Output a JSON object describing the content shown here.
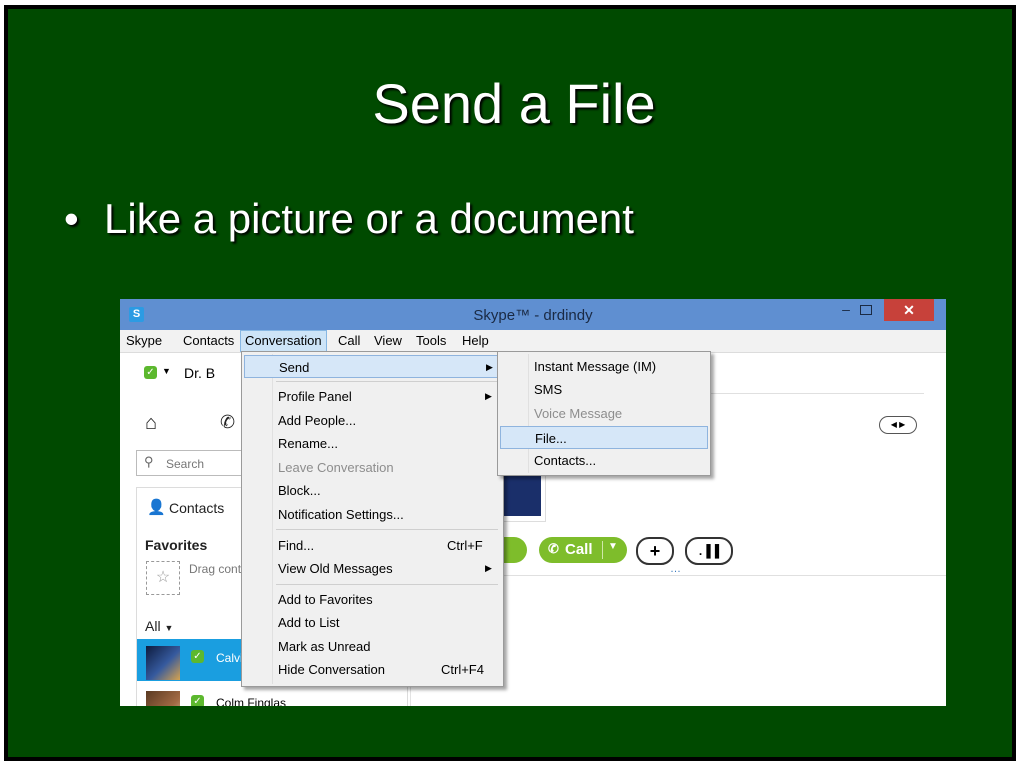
{
  "slide": {
    "title": "Send a File",
    "bullet": "Like a picture or a document"
  },
  "window": {
    "logo": "S",
    "title": "Skype™ - drdindy",
    "close_symbol": "✕",
    "min_symbol": "–"
  },
  "menubar": [
    "Skype",
    "Contacts",
    "Conversation",
    "Call",
    "View",
    "Tools",
    "Help"
  ],
  "user": {
    "name": "Dr. B"
  },
  "search": {
    "placeholder": "Search"
  },
  "contacts": {
    "header": "Contacts",
    "favorites": "Favorites",
    "drag_text": "Drag cont",
    "all_label": "All",
    "rows": [
      {
        "name": "Calvi",
        "selected": true
      },
      {
        "name": "Colm Finglas",
        "selected": false
      }
    ]
  },
  "conversation": {
    "partial_call": "all",
    "call_label": "Call",
    "add_symbol": "+",
    "signal_symbol": ".▐▐",
    "dots": "…"
  },
  "conversation_menu": {
    "items": [
      {
        "label": "Send",
        "submenu": true,
        "highlighted": true
      },
      {
        "label": "Profile Panel",
        "submenu": true
      },
      {
        "label": "Add People..."
      },
      {
        "label": "Rename..."
      },
      {
        "label": "Leave Conversation",
        "disabled": true
      },
      {
        "label": "Block..."
      },
      {
        "label": "Notification Settings..."
      },
      {
        "label": "Find...",
        "shortcut": "Ctrl+F"
      },
      {
        "label": "View Old Messages",
        "submenu": true
      },
      {
        "label": "Add to Favorites"
      },
      {
        "label": "Add to List"
      },
      {
        "label": "Mark as Unread"
      },
      {
        "label": "Hide Conversation",
        "shortcut": "Ctrl+F4"
      }
    ]
  },
  "send_submenu": {
    "items": [
      {
        "label": "Instant Message (IM)"
      },
      {
        "label": "SMS"
      },
      {
        "label": "Voice Message",
        "disabled": true
      },
      {
        "label": "File...",
        "highlighted": true
      },
      {
        "label": "Contacts..."
      }
    ]
  },
  "colors": {
    "slide_bg": "#004a00",
    "titlebar": "#5f8fd1",
    "close_btn": "#c7413a",
    "skype_green": "#7ebd2b",
    "selected_row": "#1a9ee0",
    "menu_highlight": "#d6e7f8"
  }
}
